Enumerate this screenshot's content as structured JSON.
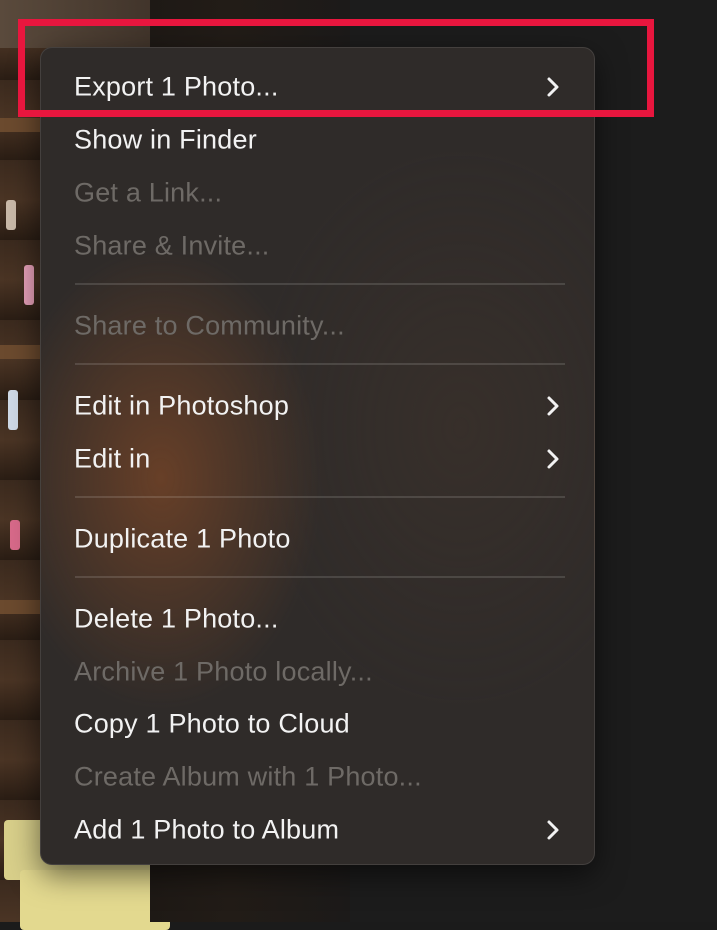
{
  "menu": {
    "items": [
      {
        "label": "Export 1 Photo...",
        "enabled": true,
        "submenu": true
      },
      {
        "label": "Show in Finder",
        "enabled": true,
        "submenu": false
      },
      {
        "label": "Get a Link...",
        "enabled": false,
        "submenu": false
      },
      {
        "label": "Share & Invite...",
        "enabled": false,
        "submenu": false
      },
      {
        "label": "Share to Community...",
        "enabled": false,
        "submenu": false
      },
      {
        "label": "Edit in Photoshop",
        "enabled": true,
        "submenu": true
      },
      {
        "label": "Edit in",
        "enabled": true,
        "submenu": true
      },
      {
        "label": "Duplicate 1 Photo",
        "enabled": true,
        "submenu": false
      },
      {
        "label": "Delete 1 Photo...",
        "enabled": true,
        "submenu": false
      },
      {
        "label": "Archive 1 Photo locally...",
        "enabled": false,
        "submenu": false
      },
      {
        "label": "Copy 1 Photo to Cloud",
        "enabled": true,
        "submenu": false
      },
      {
        "label": "Create Album with 1 Photo...",
        "enabled": false,
        "submenu": false
      },
      {
        "label": "Add 1 Photo to Album",
        "enabled": true,
        "submenu": true
      }
    ]
  },
  "icons": {
    "submenu": "chevron-right-icon"
  },
  "colors": {
    "highlight": "#e8163e",
    "enabled_text": "#f2f2f2",
    "disabled_text": "#6e6a66"
  }
}
